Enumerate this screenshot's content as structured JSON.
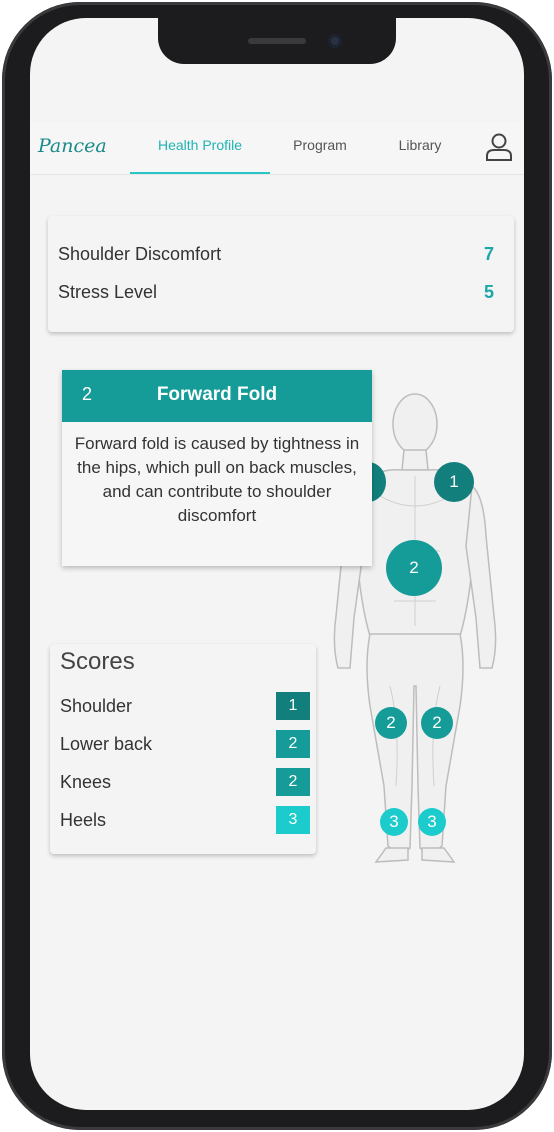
{
  "app": {
    "logo": "Pancea"
  },
  "nav": {
    "tabs": [
      {
        "label": "Health Profile",
        "active": true
      },
      {
        "label": "Program"
      },
      {
        "label": "Library"
      }
    ],
    "icons": {
      "profile": "user-icon"
    }
  },
  "metrics": [
    {
      "label": "Shoulder Discomfort",
      "value": "7"
    },
    {
      "label": "Stress Level",
      "value": "5"
    }
  ],
  "popup": {
    "number": "2",
    "title": "Forward Fold",
    "description": "Forward fold is caused by tightness in the hips, which pull on back muscles, and can contribute to shoulder discomfort"
  },
  "body_markers": [
    {
      "number": "1",
      "area": "left shoulder"
    },
    {
      "number": "1",
      "area": "right shoulder"
    },
    {
      "number": "2",
      "area": "lower back"
    },
    {
      "number": "2",
      "area": "left knee"
    },
    {
      "number": "2",
      "area": "right knee"
    },
    {
      "number": "3",
      "area": "left heel"
    },
    {
      "number": "3",
      "area": "right heel"
    }
  ],
  "scores": {
    "title": "Scores",
    "items": [
      {
        "label": "Shoulder",
        "score": "1",
        "color": "#127f7c"
      },
      {
        "label": "Lower back",
        "score": "2",
        "color": "#159c98"
      },
      {
        "label": "Knees",
        "score": "2",
        "color": "#159c98"
      },
      {
        "label": "Heels",
        "score": "3",
        "color": "#1ccbcb"
      }
    ]
  },
  "colors": {
    "accent": "#1fb5b5",
    "level1": "#127f7c",
    "level2": "#159c98",
    "level3": "#1ccbcb"
  }
}
